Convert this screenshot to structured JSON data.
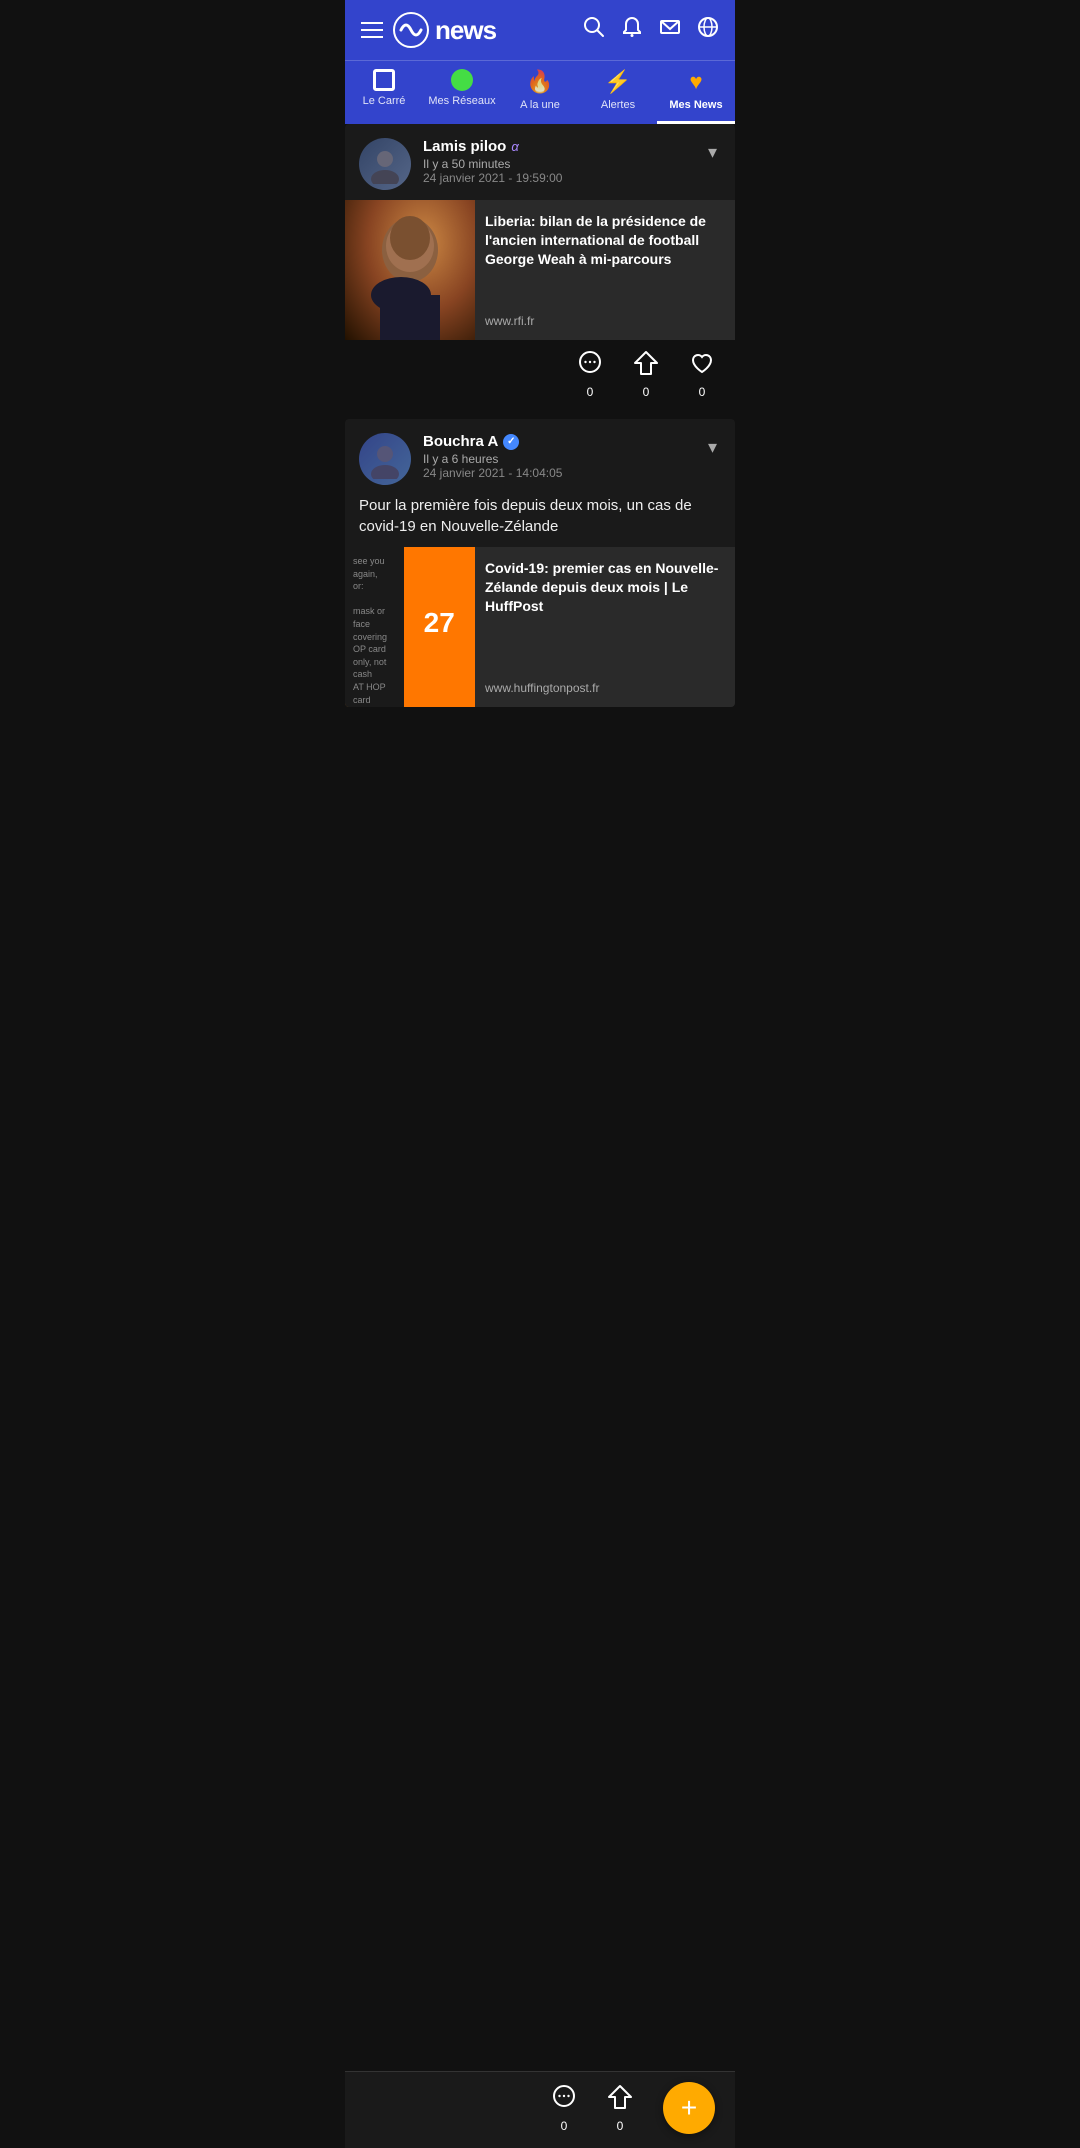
{
  "header": {
    "menu_label": "Menu",
    "logo_text": "news",
    "search_label": "Search",
    "notification_label": "Notifications",
    "mail_label": "Mail",
    "globe_label": "Globe"
  },
  "nav": {
    "tabs": [
      {
        "id": "le-carre",
        "label": "Le Carré",
        "icon_type": "square",
        "active": false
      },
      {
        "id": "mes-reseaux",
        "label": "Mes Réseaux",
        "icon_type": "green-dot",
        "active": false
      },
      {
        "id": "a-la-une",
        "label": "A la une",
        "icon_type": "fire",
        "active": false
      },
      {
        "id": "alertes",
        "label": "Alertes",
        "icon_type": "lightning",
        "active": false
      },
      {
        "id": "mes-news",
        "label": "Mes News",
        "icon_type": "heart",
        "active": true
      }
    ]
  },
  "posts": [
    {
      "id": "post-1",
      "author": "Lamis piloo",
      "author_badge": "α",
      "author_badge_type": "alpha",
      "verified": false,
      "time_ago": "Il y a 50 minutes",
      "date": "24 janvier 2021 - 19:59:00",
      "text": "",
      "news_link": {
        "title": "Liberia: bilan de la présidence de l'ancien international de football George Weah à mi-parcours",
        "source": "www.rfi.fr",
        "image_type": "george-weah"
      },
      "actions": {
        "comments": {
          "icon": "💬",
          "count": "0"
        },
        "share": {
          "icon": "◈",
          "count": "0"
        },
        "like": {
          "icon": "♡",
          "count": "0"
        }
      }
    },
    {
      "id": "post-2",
      "author": "Bouchra A",
      "author_badge": "✓",
      "author_badge_type": "verified",
      "verified": true,
      "time_ago": "Il y a 6 heures",
      "date": "24 janvier 2021 - 14:04:05",
      "text": "Pour la première fois depuis deux mois, un cas de covid-19 en Nouvelle-Zélande",
      "news_link": {
        "title": "Covid-19: premier cas en Nouvelle-Zélande depuis deux mois | Le HuffPost",
        "source": "www.huffingtonpost.fr",
        "image_type": "nz"
      },
      "actions": {
        "comments": {
          "icon": "💬",
          "count": "0"
        },
        "share": {
          "icon": "◈",
          "count": "0"
        },
        "like": {
          "icon": "♡",
          "count": "0"
        }
      }
    }
  ],
  "bottom_bar": {
    "comment_count": "0",
    "share_count": "0",
    "fab_icon": "+"
  }
}
